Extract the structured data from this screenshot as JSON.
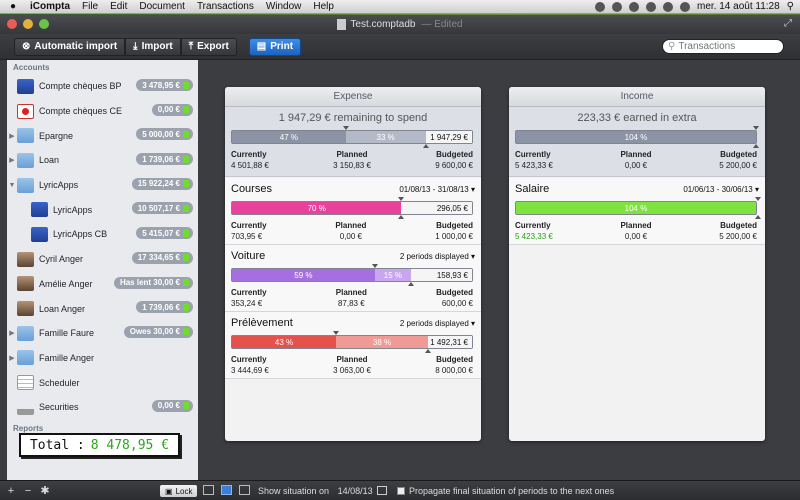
{
  "menubar": {
    "items": [
      "iCompta",
      "File",
      "Edit",
      "Document",
      "Transactions",
      "Window",
      "Help"
    ],
    "clock": "mer. 14 août  11:28"
  },
  "window": {
    "title": "Test.comptadb",
    "edited": "— Edited"
  },
  "toolbar": {
    "auto_import": "Automatic import",
    "import": "Import",
    "export": "Export",
    "print": "Print",
    "search_placeholder": "Transactions"
  },
  "sidebar": {
    "accounts_header": "Accounts",
    "reports_header": "Reports",
    "items": [
      {
        "label": "Compte chèques BP",
        "badge": "3 478,95 €",
        "icon": "bank",
        "tri": "",
        "sub": false
      },
      {
        "label": "Compte chèques CE",
        "badge": "0,00 €",
        "icon": "ce",
        "tri": "",
        "sub": false
      },
      {
        "label": "Epargne",
        "badge": "5 000,00 €",
        "icon": "folder",
        "tri": "▶",
        "sub": false
      },
      {
        "label": "Loan",
        "badge": "1 739,06 €",
        "icon": "folder",
        "tri": "▶",
        "sub": false
      },
      {
        "label": "LyricApps",
        "badge": "15 922,24 €",
        "icon": "folder",
        "tri": "▼",
        "sub": false
      },
      {
        "label": "LyricApps",
        "badge": "10 507,17 €",
        "icon": "bank",
        "tri": "",
        "sub": true
      },
      {
        "label": "LyricApps CB",
        "badge": "5 415,07 €",
        "icon": "bank",
        "tri": "",
        "sub": true
      },
      {
        "label": "Cyril Anger",
        "badge": "17 334,65 €",
        "icon": "person",
        "tri": "",
        "sub": false
      },
      {
        "label": "Amélie Anger",
        "badge": "Has lent 30,00 €",
        "icon": "person",
        "tri": "",
        "sub": false
      },
      {
        "label": "Loan Anger",
        "badge": "1 739,06 €",
        "icon": "person",
        "tri": "",
        "sub": false
      },
      {
        "label": "Famille Faure",
        "badge": "Owes 30,00 €",
        "icon": "folder",
        "tri": "▶",
        "sub": false
      },
      {
        "label": "Famille Anger",
        "badge": "",
        "icon": "folder",
        "tri": "▶",
        "sub": false
      },
      {
        "label": "Scheduler",
        "badge": "",
        "icon": "sched",
        "tri": "",
        "sub": false
      },
      {
        "label": "Securities",
        "badge": "0,00 €",
        "icon": "sec",
        "tri": "",
        "sub": false
      }
    ],
    "total_label": "Total :",
    "total_value": "8 478,95 €"
  },
  "bottombar": {
    "add": "+",
    "remove": "−",
    "gear": "✱",
    "lock": "Lock",
    "show_situation": "Show situation on",
    "situation_date": "14/08/13",
    "propagate": "Propagate final situation of periods to the next ones"
  },
  "labels": {
    "currently": "Currently",
    "planned": "Planned",
    "budgeted": "Budgeted"
  },
  "expense": {
    "title": "Expense",
    "remaining": "1 947,29 € remaining to spend",
    "bar": {
      "pct1": "47 %",
      "pct2": "33 %",
      "rest": "1 947,29 €",
      "f1": 0.47,
      "f2": 0.33
    },
    "currently": "4 501,88 €",
    "planned": "3 150,83 €",
    "budgeted": "9 600,00 €",
    "categories": [
      {
        "name": "Courses",
        "period": "01/08/13 - 31/08/13 ▾",
        "pct1": "70 %",
        "pct2": "",
        "rest": "296,05 €",
        "f1": 0.7,
        "f2": 0,
        "color1": "#e8429c",
        "color2": "#f08cc4",
        "currently": "703,95 €",
        "planned": "0,00 €",
        "budgeted": "1 000,00 €"
      },
      {
        "name": "Voiture",
        "period": "2 periods displayed ▾",
        "pct1": "59 %",
        "pct2": "15 %",
        "rest": "158,93 €",
        "f1": 0.59,
        "f2": 0.15,
        "color1": "#a56fe0",
        "color2": "#c9a7ef",
        "currently": "353,24 €",
        "planned": "87,83 €",
        "budgeted": "600,00 €"
      },
      {
        "name": "Prélèvement",
        "period": "2 periods displayed ▾",
        "pct1": "43 %",
        "pct2": "38 %",
        "rest": "1 492,31 €",
        "f1": 0.43,
        "f2": 0.38,
        "color1": "#e5524b",
        "color2": "#ef9a94",
        "currently": "3 444,69 €",
        "planned": "3 063,00 €",
        "budgeted": "8 000,00 €"
      }
    ]
  },
  "income": {
    "title": "Income",
    "extra": "223,33 € earned in extra",
    "bar": {
      "pct1": "104 %",
      "f1": 1.0
    },
    "currently": "5 423,33 €",
    "planned": "0,00 €",
    "budgeted": "5 200,00 €",
    "categories": [
      {
        "name": "Salaire",
        "period": "01/06/13 - 30/06/13 ▾",
        "pct1": "104 %",
        "f1": 1.0,
        "color1": "#7ee23f",
        "currently": "5 423,33 €",
        "planned": "0,00 €",
        "budgeted": "5 200,00 €"
      }
    ]
  }
}
